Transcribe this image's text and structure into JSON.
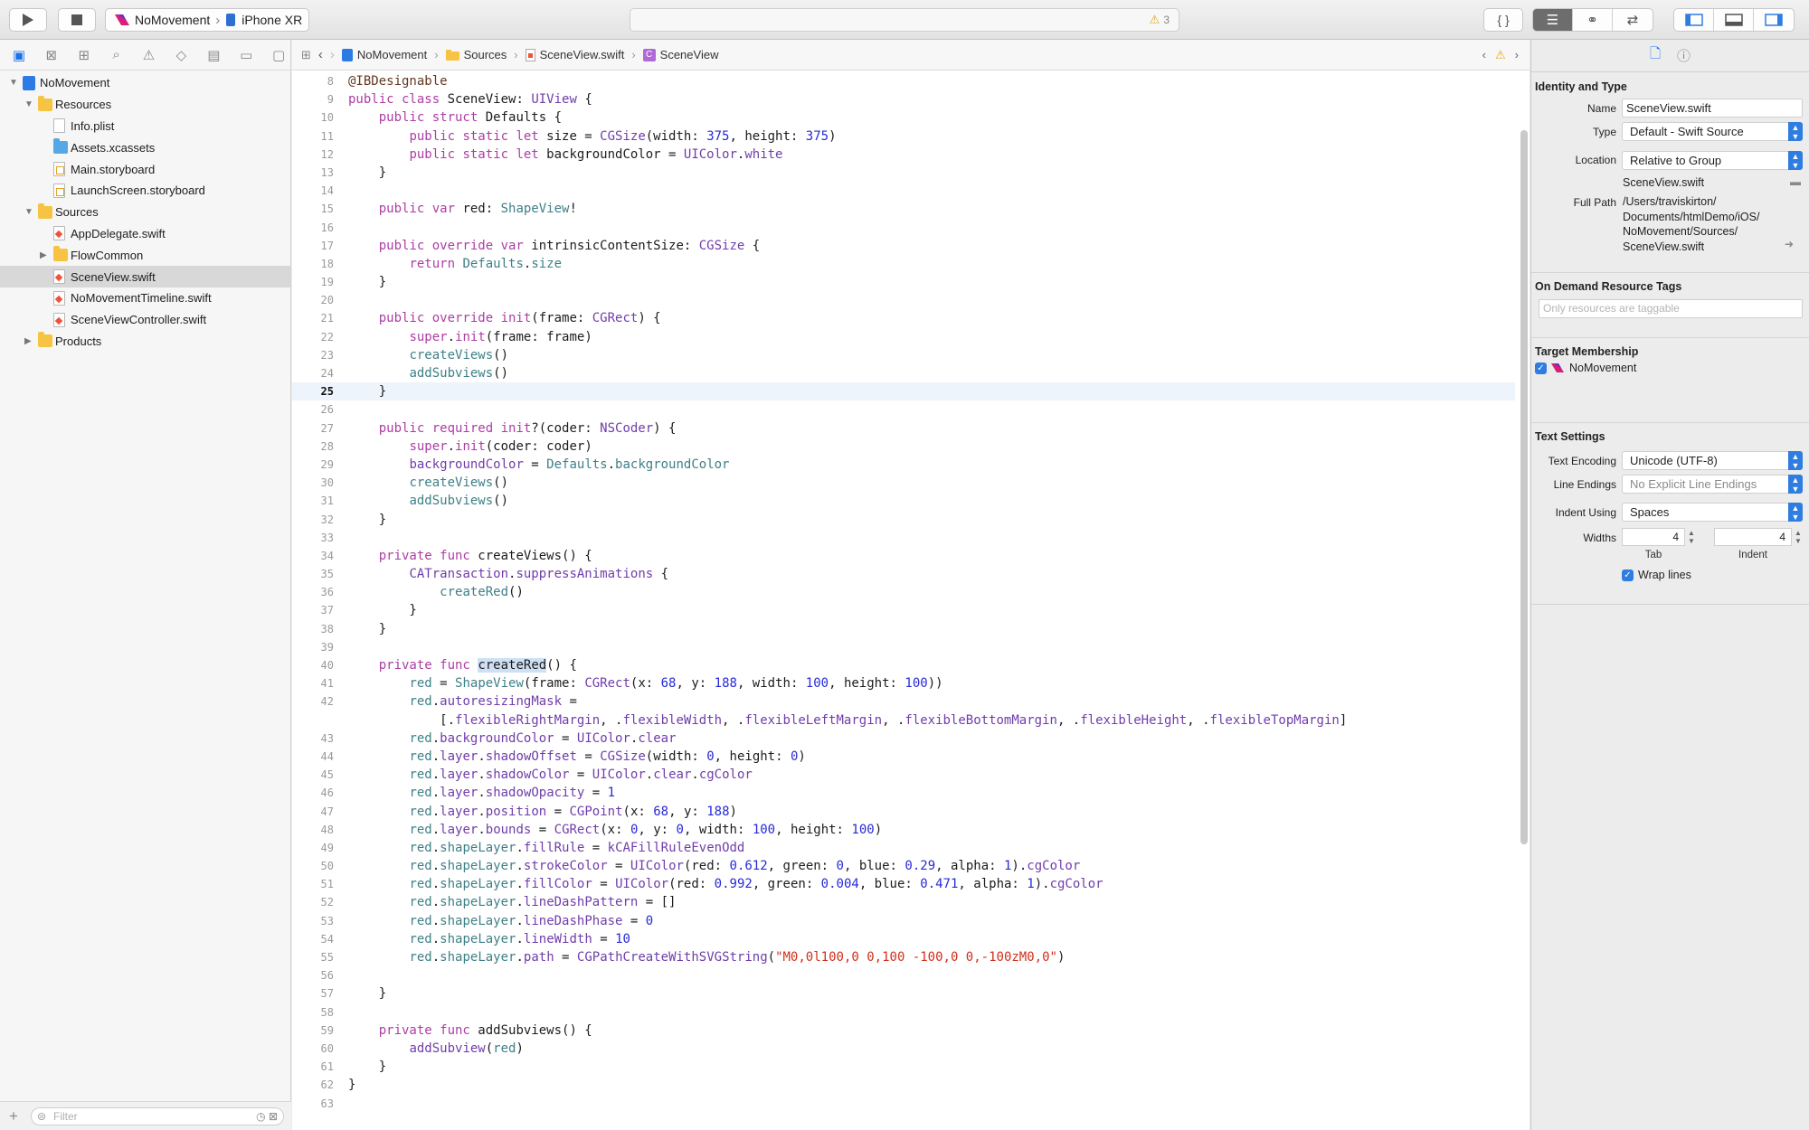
{
  "toolbar": {
    "scheme": "NoMovement",
    "device": "iPhone XR",
    "warning_count": "3"
  },
  "navigator": {
    "tree": [
      {
        "label": "NoMovement",
        "indent": 0,
        "disclosure": "open",
        "icon": "project"
      },
      {
        "label": "Resources",
        "indent": 1,
        "disclosure": "open",
        "icon": "folder"
      },
      {
        "label": "Info.plist",
        "indent": 2,
        "disclosure": "",
        "icon": "file"
      },
      {
        "label": "Assets.xcassets",
        "indent": 2,
        "disclosure": "",
        "icon": "folder-blue"
      },
      {
        "label": "Main.storyboard",
        "indent": 2,
        "disclosure": "",
        "icon": "storyboard"
      },
      {
        "label": "LaunchScreen.storyboard",
        "indent": 2,
        "disclosure": "",
        "icon": "storyboard"
      },
      {
        "label": "Sources",
        "indent": 1,
        "disclosure": "open",
        "icon": "folder"
      },
      {
        "label": "AppDelegate.swift",
        "indent": 2,
        "disclosure": "",
        "icon": "swift"
      },
      {
        "label": "FlowCommon",
        "indent": 2,
        "disclosure": "closed",
        "icon": "folder"
      },
      {
        "label": "SceneView.swift",
        "indent": 2,
        "disclosure": "",
        "icon": "swift",
        "selected": true
      },
      {
        "label": "NoMovementTimeline.swift",
        "indent": 2,
        "disclosure": "",
        "icon": "swift"
      },
      {
        "label": "SceneViewController.swift",
        "indent": 2,
        "disclosure": "",
        "icon": "swift"
      },
      {
        "label": "Products",
        "indent": 1,
        "disclosure": "closed",
        "icon": "folder"
      }
    ],
    "filter_placeholder": "Filter"
  },
  "jumpbar": {
    "project": "NoMovement",
    "folder": "Sources",
    "file": "SceneView.swift",
    "symbol": "SceneView"
  },
  "editor": {
    "current_line": 25,
    "lines": [
      {
        "n": "8",
        "html": "<span class=\"a\">@IBDesignable</span>"
      },
      {
        "n": "9",
        "html": "<span class=\"k\">public class</span> SceneView: <span class=\"ty\">UIView</span> {"
      },
      {
        "n": "10",
        "html": "    <span class=\"k\">public struct</span> Defaults {"
      },
      {
        "n": "11",
        "html": "        <span class=\"k\">public static let</span> size = <span class=\"ty\">CGSize</span>(width: <span class=\"n\">375</span>, height: <span class=\"n\">375</span>)"
      },
      {
        "n": "12",
        "html": "        <span class=\"k\">public static let</span> backgroundColor = <span class=\"ty\">UIColor</span>.<span class=\"ty\">white</span>"
      },
      {
        "n": "13",
        "html": "    }"
      },
      {
        "n": "14",
        "html": ""
      },
      {
        "n": "15",
        "html": "    <span class=\"k\">public var</span> red: <span class=\"t\">ShapeView</span>!"
      },
      {
        "n": "16",
        "html": ""
      },
      {
        "n": "17",
        "html": "    <span class=\"k\">public override var</span> intrinsicContentSize: <span class=\"ty\">CGSize</span> {"
      },
      {
        "n": "18",
        "html": "        <span class=\"k\">return</span> <span class=\"t\">Defaults</span>.<span class=\"t\">size</span>"
      },
      {
        "n": "19",
        "html": "    }"
      },
      {
        "n": "20",
        "html": ""
      },
      {
        "n": "21",
        "html": "    <span class=\"k\">public override init</span>(frame: <span class=\"ty\">CGRect</span>) {"
      },
      {
        "n": "22",
        "html": "        <span class=\"k\">super</span>.<span class=\"k\">init</span>(frame: frame)"
      },
      {
        "n": "23",
        "html": "        <span class=\"p\">createViews</span>()"
      },
      {
        "n": "24",
        "html": "        <span class=\"p\">addSubviews</span>()"
      },
      {
        "n": "25",
        "html": "    }"
      },
      {
        "n": "26",
        "html": ""
      },
      {
        "n": "27",
        "html": "    <span class=\"k\">public required init</span>?(coder: <span class=\"ty\">NSCoder</span>) {"
      },
      {
        "n": "28",
        "html": "        <span class=\"k\">super</span>.<span class=\"k\">init</span>(coder: coder)"
      },
      {
        "n": "29",
        "html": "        <span class=\"ty\">backgroundColor</span> = <span class=\"t\">Defaults</span>.<span class=\"t\">backgroundColor</span>"
      },
      {
        "n": "30",
        "html": "        <span class=\"p\">createViews</span>()"
      },
      {
        "n": "31",
        "html": "        <span class=\"p\">addSubviews</span>()"
      },
      {
        "n": "32",
        "html": "    }"
      },
      {
        "n": "33",
        "html": ""
      },
      {
        "n": "34",
        "html": "    <span class=\"k\">private func</span> createViews() {"
      },
      {
        "n": "35",
        "html": "        <span class=\"ty\">CATransaction</span>.<span class=\"ty\">suppressAnimations</span> {"
      },
      {
        "n": "36",
        "html": "            <span class=\"p\">createRed</span>()"
      },
      {
        "n": "37",
        "html": "        }"
      },
      {
        "n": "38",
        "html": "    }"
      },
      {
        "n": "39",
        "html": ""
      },
      {
        "n": "40",
        "html": "    <span class=\"k\">private func</span> <span class=\"hl\">createRed</span>() {"
      },
      {
        "n": "41",
        "html": "        <span class=\"t\">red</span> = <span class=\"t\">ShapeView</span>(frame: <span class=\"ty\">CGRect</span>(x: <span class=\"n\">68</span>, y: <span class=\"n\">188</span>, width: <span class=\"n\">100</span>, height: <span class=\"n\">100</span>))"
      },
      {
        "n": "42",
        "html": "        <span class=\"t\">red</span>.<span class=\"ty\">autoresizingMask</span> ="
      },
      {
        "n": "",
        "html": "            [.<span class=\"ty\">flexibleRightMargin</span>, .<span class=\"ty\">flexibleWidth</span>, .<span class=\"ty\">flexibleLeftMargin</span>, .<span class=\"ty\">flexibleBottomMargin</span>, .<span class=\"ty\">flexibleHeight</span>, .<span class=\"ty\">flexibleTopMargin</span>]"
      },
      {
        "n": "43",
        "html": "        <span class=\"t\">red</span>.<span class=\"ty\">backgroundColor</span> = <span class=\"ty\">UIColor</span>.<span class=\"ty\">clear</span>"
      },
      {
        "n": "44",
        "html": "        <span class=\"t\">red</span>.<span class=\"ty\">layer</span>.<span class=\"ty\">shadowOffset</span> = <span class=\"ty\">CGSize</span>(width: <span class=\"n\">0</span>, height: <span class=\"n\">0</span>)"
      },
      {
        "n": "45",
        "html": "        <span class=\"t\">red</span>.<span class=\"ty\">layer</span>.<span class=\"ty\">shadowColor</span> = <span class=\"ty\">UIColor</span>.<span class=\"ty\">clear</span>.<span class=\"ty\">cgColor</span>"
      },
      {
        "n": "46",
        "html": "        <span class=\"t\">red</span>.<span class=\"ty\">layer</span>.<span class=\"ty\">shadowOpacity</span> = <span class=\"n\">1</span>"
      },
      {
        "n": "47",
        "html": "        <span class=\"t\">red</span>.<span class=\"ty\">layer</span>.<span class=\"ty\">position</span> = <span class=\"ty\">CGPoint</span>(x: <span class=\"n\">68</span>, y: <span class=\"n\">188</span>)"
      },
      {
        "n": "48",
        "html": "        <span class=\"t\">red</span>.<span class=\"ty\">layer</span>.<span class=\"ty\">bounds</span> = <span class=\"ty\">CGRect</span>(x: <span class=\"n\">0</span>, y: <span class=\"n\">0</span>, width: <span class=\"n\">100</span>, height: <span class=\"n\">100</span>)"
      },
      {
        "n": "49",
        "html": "        <span class=\"t\">red</span>.<span class=\"t\">shapeLayer</span>.<span class=\"ty\">fillRule</span> = <span class=\"ty\">kCAFillRuleEvenOdd</span>"
      },
      {
        "n": "50",
        "html": "        <span class=\"t\">red</span>.<span class=\"t\">shapeLayer</span>.<span class=\"ty\">strokeColor</span> = <span class=\"ty\">UIColor</span>(red: <span class=\"n\">0.612</span>, green: <span class=\"n\">0</span>, blue: <span class=\"n\">0.29</span>, alpha: <span class=\"n\">1</span>).<span class=\"ty\">cgColor</span>"
      },
      {
        "n": "51",
        "html": "        <span class=\"t\">red</span>.<span class=\"t\">shapeLayer</span>.<span class=\"ty\">fillColor</span> = <span class=\"ty\">UIColor</span>(red: <span class=\"n\">0.992</span>, green: <span class=\"n\">0.004</span>, blue: <span class=\"n\">0.471</span>, alpha: <span class=\"n\">1</span>).<span class=\"ty\">cgColor</span>"
      },
      {
        "n": "52",
        "html": "        <span class=\"t\">red</span>.<span class=\"t\">shapeLayer</span>.<span class=\"ty\">lineDashPattern</span> = []"
      },
      {
        "n": "53",
        "html": "        <span class=\"t\">red</span>.<span class=\"t\">shapeLayer</span>.<span class=\"ty\">lineDashPhase</span> = <span class=\"n\">0</span>"
      },
      {
        "n": "54",
        "html": "        <span class=\"t\">red</span>.<span class=\"t\">shapeLayer</span>.<span class=\"ty\">lineWidth</span> = <span class=\"n\">10</span>"
      },
      {
        "n": "55",
        "html": "        <span class=\"t\">red</span>.<span class=\"t\">shapeLayer</span>.<span class=\"ty\">path</span> = <span class=\"ty\">CGPathCreateWithSVGString</span>(<span class=\"s\">\"M0,0l100,0 0,100 -100,0 0,-100zM0,0\"</span>)"
      },
      {
        "n": "56",
        "html": ""
      },
      {
        "n": "57",
        "html": "    }"
      },
      {
        "n": "58",
        "html": ""
      },
      {
        "n": "59",
        "html": "    <span class=\"k\">private func</span> addSubviews() {"
      },
      {
        "n": "60",
        "html": "        <span class=\"ty\">addSubview</span>(<span class=\"t\">red</span>)"
      },
      {
        "n": "61",
        "html": "    }"
      },
      {
        "n": "62",
        "html": "}"
      },
      {
        "n": "63",
        "html": ""
      }
    ]
  },
  "inspector": {
    "identity_title": "Identity and Type",
    "name_label": "Name",
    "name_value": "SceneView.swift",
    "type_label": "Type",
    "type_value": "Default - Swift Source",
    "location_label": "Location",
    "location_value": "Relative to Group",
    "location_file": "SceneView.swift",
    "fullpath_label": "Full Path",
    "fullpath_lines": [
      "/Users/traviskirton/",
      "Documents/htmlDemo/iOS/",
      "NoMovement/Sources/",
      "SceneView.swift"
    ],
    "odr_title": "On Demand Resource Tags",
    "odr_placeholder": "Only resources are taggable",
    "target_title": "Target Membership",
    "target_name": "NoMovement",
    "text_title": "Text Settings",
    "encoding_label": "Text Encoding",
    "encoding_value": "Unicode (UTF-8)",
    "line_endings_label": "Line Endings",
    "line_endings_value": "No Explicit Line Endings",
    "indent_using_label": "Indent Using",
    "indent_using_value": "Spaces",
    "widths_label": "Widths",
    "tab_width": "4",
    "indent_width": "4",
    "tab_label": "Tab",
    "indent_label": "Indent",
    "wrap_label": "Wrap lines"
  }
}
